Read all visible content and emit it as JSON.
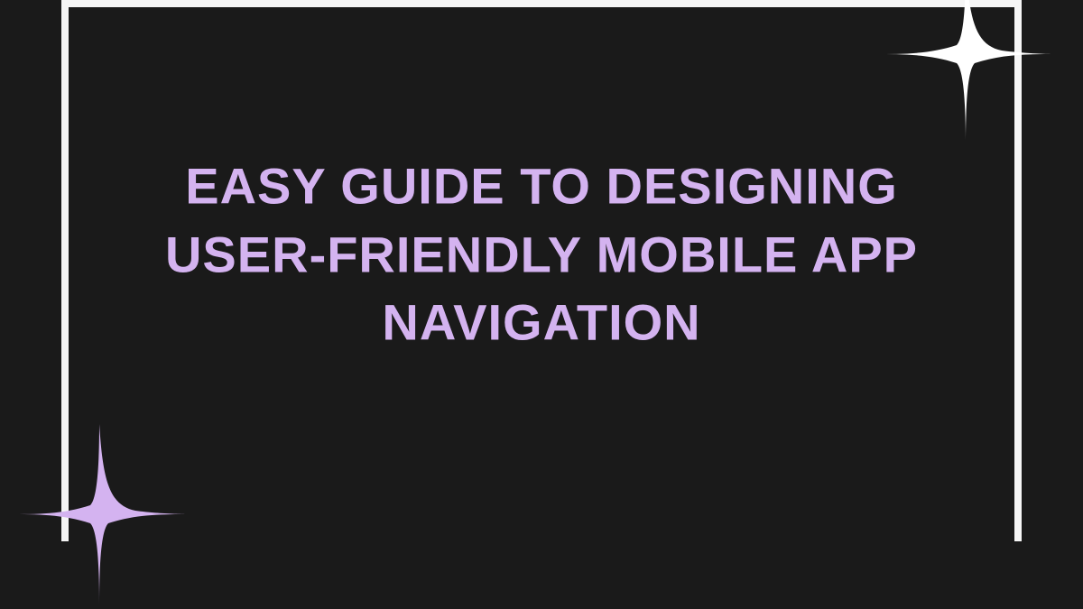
{
  "title": "EASY GUIDE TO DESIGNING USER-FRIENDLY MOBILE APP NAVIGATION",
  "colors": {
    "background": "#1a1a1a",
    "text": "#d4b3f0",
    "frame": "#f5f5f5",
    "sparkle_top": "#ffffff",
    "sparkle_bottom": "#d4b3f0"
  }
}
